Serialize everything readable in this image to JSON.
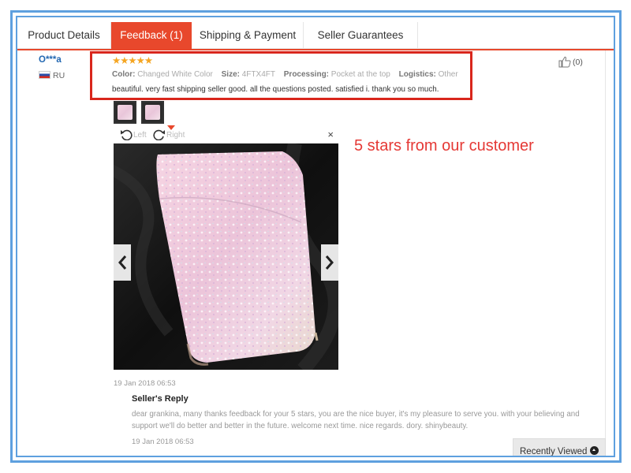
{
  "tabs": [
    {
      "label": "Product Details",
      "active": false
    },
    {
      "label": "Feedback (1)",
      "active": true
    },
    {
      "label": "Shipping & Payment",
      "active": false
    },
    {
      "label": "Seller Guarantees",
      "active": false
    }
  ],
  "reviewer": {
    "name": "O***a",
    "country": "RU"
  },
  "review": {
    "stars": "★★★★★",
    "rating": 5,
    "attributes": [
      {
        "key": "Color:",
        "value": "Changed White Color"
      },
      {
        "key": "Size:",
        "value": "4FTX4FT"
      },
      {
        "key": "Processing:",
        "value": "Pocket at the top"
      },
      {
        "key": "Logistics:",
        "value": "Other"
      }
    ],
    "text": "beautiful. very fast shipping seller good. all the questions posted. satisfied i. thank you so much.",
    "helpful_count": "(0)",
    "date": "19 Jan 2018 06:53"
  },
  "viewer": {
    "rotate_left": "Left",
    "rotate_right": "Right",
    "close": "×"
  },
  "caption": "5 stars from our customer",
  "seller_reply": {
    "title": "Seller's Reply",
    "text": "dear grankina, many thanks feedback for your 5 stars, you are the nice buyer, it's my pleasure to serve you. with your believing and support we'll do better and better in the future. welcome next time. nice regards. dory. shinybeauty.",
    "date": "19 Jan 2018 06:53"
  },
  "recently_viewed": {
    "label": "Recently Viewed"
  },
  "colors": {
    "accent": "#e8482c",
    "highlight": "#d9261c",
    "star": "#f5a623",
    "caption": "#e53935",
    "frame": "#5ea0df"
  }
}
